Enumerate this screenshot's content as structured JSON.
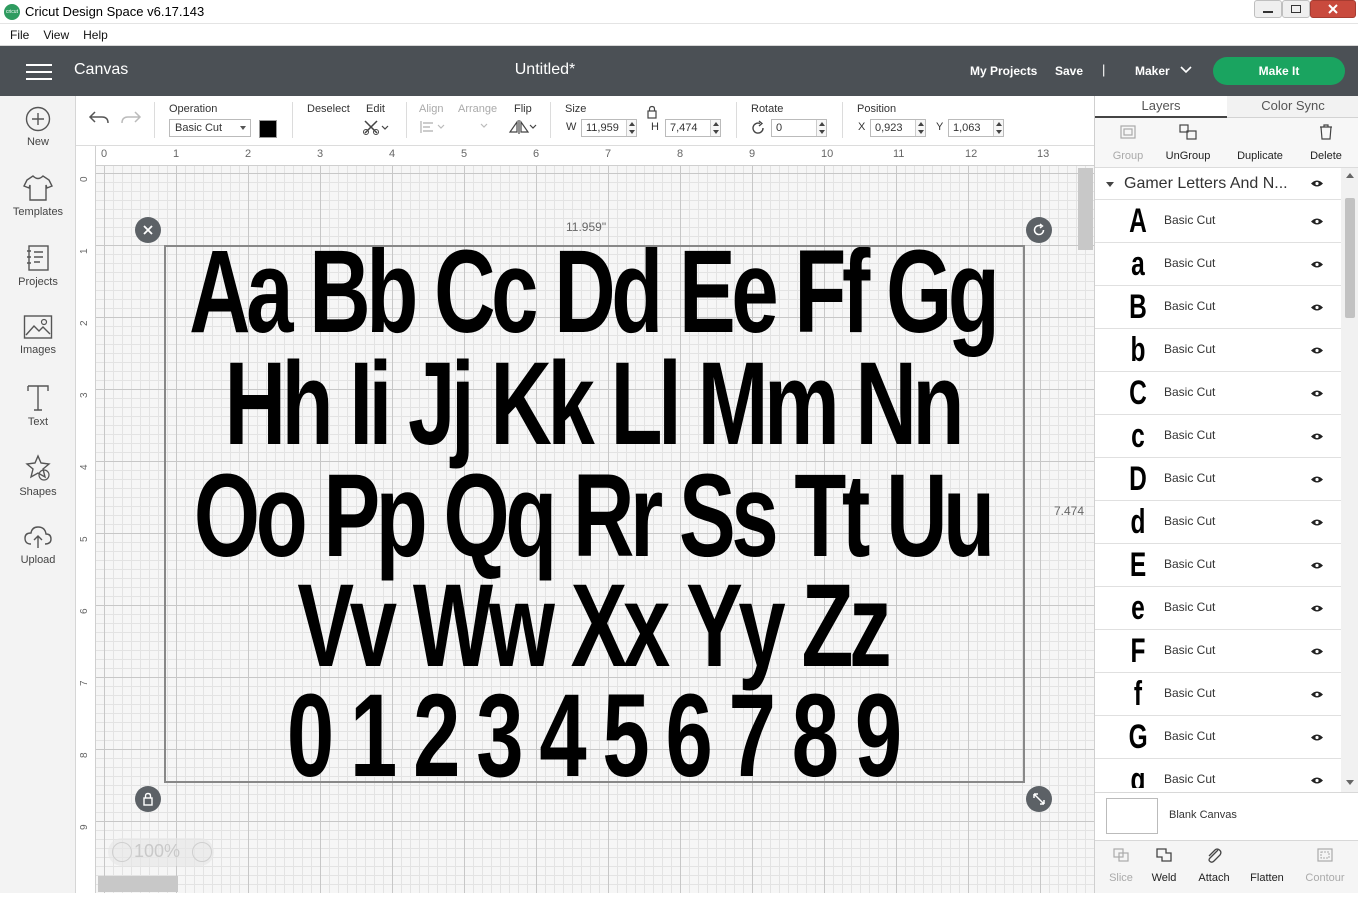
{
  "window": {
    "title": "Cricut Design Space  v6.17.143",
    "app_icon_text": "cricut"
  },
  "menubar": {
    "items": [
      "File",
      "View",
      "Help"
    ]
  },
  "header": {
    "section": "Canvas",
    "document_title": "Untitled*",
    "my_projects": "My Projects",
    "save": "Save",
    "separator": "|",
    "machine": "Maker",
    "make_it": "Make It",
    "accent_color": "#1aa460",
    "bar_color": "#4b5055"
  },
  "left_rail": [
    {
      "label": "New",
      "icon": "plus-circle-icon"
    },
    {
      "label": "Templates",
      "icon": "tshirt-icon"
    },
    {
      "label": "Projects",
      "icon": "projects-icon"
    },
    {
      "label": "Images",
      "icon": "image-icon"
    },
    {
      "label": "Text",
      "icon": "text-icon"
    },
    {
      "label": "Shapes",
      "icon": "shapes-icon"
    },
    {
      "label": "Upload",
      "icon": "upload-icon"
    }
  ],
  "toolbar": {
    "operation_label": "Operation",
    "operation_value": "Basic Cut",
    "operation_color": "#000000",
    "deselect": "Deselect",
    "edit": "Edit",
    "align": "Align",
    "arrange": "Arrange",
    "flip": "Flip",
    "size_label": "Size",
    "w_prefix": "W",
    "w_value": "11,959",
    "h_prefix": "H",
    "h_value": "7,474",
    "rotate_label": "Rotate",
    "rotate_value": "0",
    "position_label": "Position",
    "x_prefix": "X",
    "x_value": "0,923",
    "y_prefix": "Y",
    "y_value": "1,063"
  },
  "rulers": {
    "top": [
      "0",
      "1",
      "2",
      "3",
      "4",
      "5",
      "6",
      "7",
      "8",
      "9",
      "10",
      "11",
      "12",
      "13"
    ],
    "left": [
      "0",
      "1",
      "2",
      "3",
      "4",
      "5",
      "6",
      "7",
      "8",
      "9"
    ]
  },
  "canvas": {
    "width_readout": "11.959\"",
    "height_readout": "7.474",
    "zoom": "100%",
    "rows": [
      [
        "Aa",
        "Bb",
        "Cc",
        "Dd",
        "Ee",
        "Ff",
        "Gg"
      ],
      [
        "Hh",
        "Ii",
        "Jj",
        "Kk",
        "Ll",
        "Mm",
        "Nn"
      ],
      [
        "Oo",
        "Pp",
        "Qq",
        "Rr",
        "Ss",
        "Tt",
        "Uu"
      ],
      [
        "Vv",
        "Ww",
        "Xx",
        "Yy",
        "Zz"
      ],
      [
        "0",
        "1",
        "2",
        "3",
        "4",
        "5",
        "6",
        "7",
        "8",
        "9"
      ]
    ]
  },
  "layers_panel": {
    "tabs": [
      "Layers",
      "Color Sync"
    ],
    "tools": [
      {
        "label": "Group",
        "enabled": false
      },
      {
        "label": "UnGroup",
        "enabled": true
      },
      {
        "label": "Duplicate",
        "enabled": true
      },
      {
        "label": "Delete",
        "enabled": true
      }
    ],
    "group_name": "Gamer Letters And N...",
    "layers": [
      {
        "glyph": "A",
        "name": "Basic Cut"
      },
      {
        "glyph": "a",
        "name": "Basic Cut"
      },
      {
        "glyph": "B",
        "name": "Basic Cut"
      },
      {
        "glyph": "b",
        "name": "Basic Cut"
      },
      {
        "glyph": "C",
        "name": "Basic Cut"
      },
      {
        "glyph": "c",
        "name": "Basic Cut"
      },
      {
        "glyph": "D",
        "name": "Basic Cut"
      },
      {
        "glyph": "d",
        "name": "Basic Cut"
      },
      {
        "glyph": "E",
        "name": "Basic Cut"
      },
      {
        "glyph": "e",
        "name": "Basic Cut"
      },
      {
        "glyph": "F",
        "name": "Basic Cut"
      },
      {
        "glyph": "f",
        "name": "Basic Cut"
      },
      {
        "glyph": "G",
        "name": "Basic Cut"
      },
      {
        "glyph": "g",
        "name": "Basic Cut"
      }
    ],
    "blank_canvas": "Blank Canvas",
    "bottom_tools": [
      {
        "label": "Slice",
        "enabled": false
      },
      {
        "label": "Weld",
        "enabled": true
      },
      {
        "label": "Attach",
        "enabled": true
      },
      {
        "label": "Flatten",
        "enabled": true
      },
      {
        "label": "Contour",
        "enabled": false
      }
    ]
  }
}
